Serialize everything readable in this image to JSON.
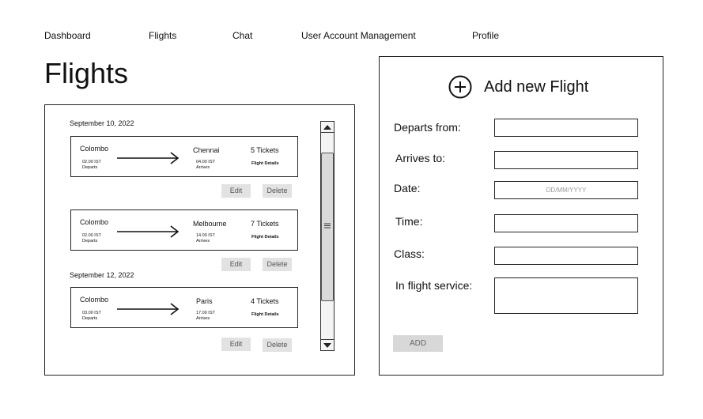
{
  "nav": {
    "dashboard": "Dashboard",
    "flights": "Flights",
    "chat": "Chat",
    "user_account_management": "User Account Management",
    "profile": "Profile"
  },
  "page": {
    "title": "Flights"
  },
  "groups": [
    {
      "date": "September 10, 2022"
    },
    {
      "date": "September 12, 2022"
    }
  ],
  "flights": [
    {
      "origin": "Colombo",
      "dep_time": "02.00 IST",
      "dep_label": "Departs",
      "destination": "Chennai",
      "arr_time": "04.00 IST",
      "arr_label": "Arrives",
      "tickets": "5 Tickets",
      "details": "Flight Details",
      "edit": "Edit",
      "delete": "Delete"
    },
    {
      "origin": "Colombo",
      "dep_time": "02.00 IST",
      "dep_label": "Departs",
      "destination": "Melbourne",
      "arr_time": "14.00 IST",
      "arr_label": "Arrives",
      "tickets": "7 Tickets",
      "details": "Flight Details",
      "edit": "Edit",
      "delete": "Delete"
    },
    {
      "origin": "Colombo",
      "dep_time": "03.00 IST",
      "dep_label": "Departs",
      "destination": "Paris",
      "arr_time": "17.00 IST",
      "arr_label": "Arrives",
      "tickets": "4 Tickets",
      "details": "Flight Details",
      "edit": "Edit",
      "delete": "Delete"
    }
  ],
  "form": {
    "title": "Add new Flight",
    "icon": "plus-circle-icon",
    "departs_label": "Departs from:",
    "arrives_label": "Arrives to:",
    "date_label": "Date:",
    "date_placeholder": "DD/MM/YYYY",
    "time_label": "Time:",
    "class_label": "Class:",
    "service_label": "In flight service:",
    "add_button": "ADD"
  }
}
